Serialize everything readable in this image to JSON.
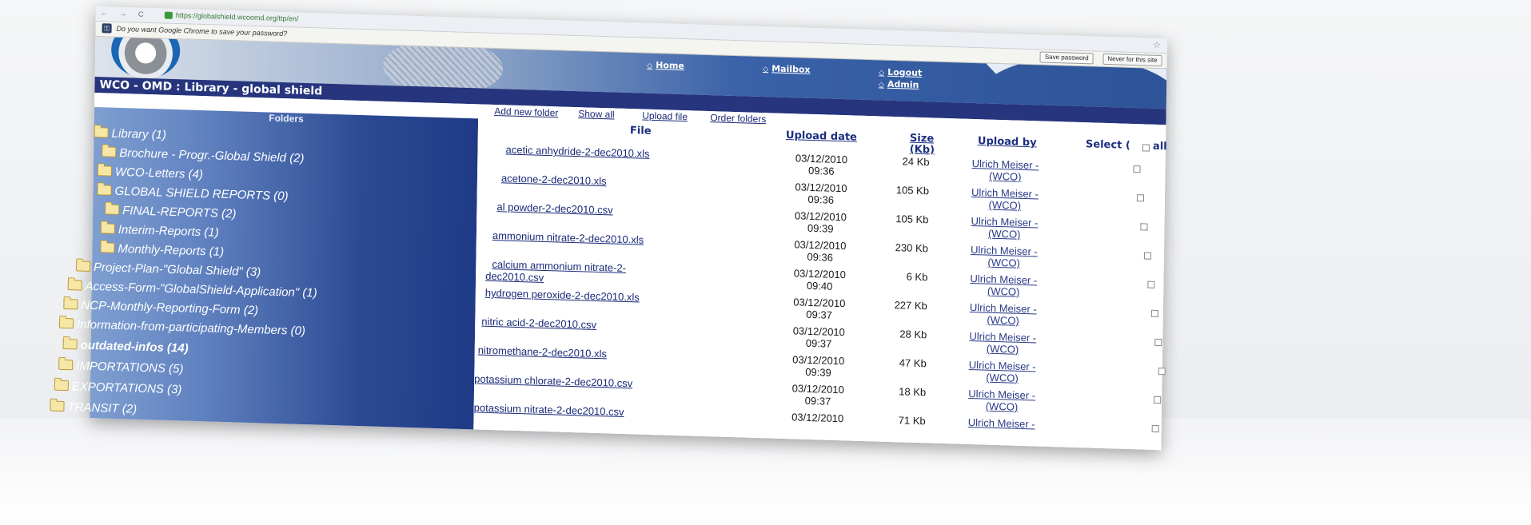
{
  "browser": {
    "url": "https://globalshield.wcoomd.org/ttp/en/",
    "nav_icons": "← → C",
    "password_prompt": "Do you want Google Chrome to save your password?",
    "save_password": "Save password",
    "never_for_site": "Never for this site"
  },
  "site": {
    "nav": {
      "home": "Home",
      "mailbox": "Mailbox",
      "logout": "Logout",
      "admin": "Admin"
    },
    "title": "WCO - OMD : Library - global shield",
    "toolbar": {
      "add_folder": "Add new folder",
      "show_all": "Show all",
      "upload_file": "Upload file",
      "order_folders": "Order folders"
    }
  },
  "sidebar": {
    "header": "Folders",
    "items": [
      {
        "label": "Library (1)"
      },
      {
        "label": "Brochure - Progr.-Global Shield (2)"
      },
      {
        "label": "WCO-Letters (4)"
      },
      {
        "label": "GLOBAL SHIELD REPORTS (0)"
      },
      {
        "label": "FINAL-REPORTS (2)"
      },
      {
        "label": "Interim-Reports (1)"
      },
      {
        "label": "Monthly-Reports (1)"
      },
      {
        "label": "Project-Plan-\"Global Shield\" (3)"
      },
      {
        "label": "Access-Form-\"GlobalShield-Application\" (1)"
      },
      {
        "label": "NCP-Monthly-Reporting-Form (2)"
      },
      {
        "label": "Information-from-participating-Members (0)"
      },
      {
        "label": "outdated-infos (14)"
      },
      {
        "label": "IMPORTATIONS (5)"
      },
      {
        "label": "EXPORTATIONS (3)"
      },
      {
        "label": "TRANSIT (2)"
      }
    ]
  },
  "table": {
    "headers": {
      "file": "File",
      "upload_date": "Upload date",
      "size": "Size (Kb)",
      "upload_by": "Upload by",
      "select": "Select (",
      "all": "all"
    },
    "rows": [
      {
        "file": "acetic anhydride-2-dec2010.xls",
        "date": "03/12/2010",
        "time": "09:36",
        "size": "24 Kb",
        "by1": "Ulrich Meiser -",
        "by2": "(WCO)"
      },
      {
        "file": "acetone-2-dec2010.xls",
        "date": "03/12/2010",
        "time": "09:36",
        "size": "105 Kb",
        "by1": "Ulrich Meiser -",
        "by2": "(WCO)"
      },
      {
        "file": "al powder-2-dec2010.csv",
        "date": "03/12/2010",
        "time": "09:39",
        "size": "105 Kb",
        "by1": "Ulrich Meiser -",
        "by2": "(WCO)"
      },
      {
        "file": "ammonium nitrate-2-dec2010.xls",
        "date": "03/12/2010",
        "time": "09:36",
        "size": "230 Kb",
        "by1": "Ulrich Meiser -",
        "by2": "(WCO)"
      },
      {
        "file": "calcium ammonium nitrate-2-",
        "file2": "dec2010.csv",
        "date": "03/12/2010",
        "time": "09:40",
        "size": "6 Kb",
        "by1": "Ulrich Meiser -",
        "by2": "(WCO)"
      },
      {
        "file": "hydrogen peroxide-2-dec2010.xls",
        "date": "03/12/2010",
        "time": "09:37",
        "size": "227 Kb",
        "by1": "Ulrich Meiser -",
        "by2": "(WCO)"
      },
      {
        "file": "nitric acid-2-dec2010.csv",
        "date": "03/12/2010",
        "time": "09:37",
        "size": "28 Kb",
        "by1": "Ulrich Meiser -",
        "by2": "(WCO)"
      },
      {
        "file": "nitromethane-2-dec2010.xls",
        "date": "03/12/2010",
        "time": "09:39",
        "size": "47 Kb",
        "by1": "Ulrich Meiser -",
        "by2": "(WCO)"
      },
      {
        "file": "potassium chlorate-2-dec2010.csv",
        "date": "03/12/2010",
        "time": "09:37",
        "size": "18 Kb",
        "by1": "Ulrich Meiser -",
        "by2": "(WCO)"
      },
      {
        "file": "potassium nitrate-2-dec2010.csv",
        "date": "03/12/2010",
        "time": "",
        "size": "71 Kb",
        "by1": "Ulrich Meiser -",
        "by2": ""
      }
    ]
  },
  "colors": {
    "title_bar": "#26357d",
    "sidebar_dark": "#1f3a86",
    "link": "#1a2a78"
  }
}
